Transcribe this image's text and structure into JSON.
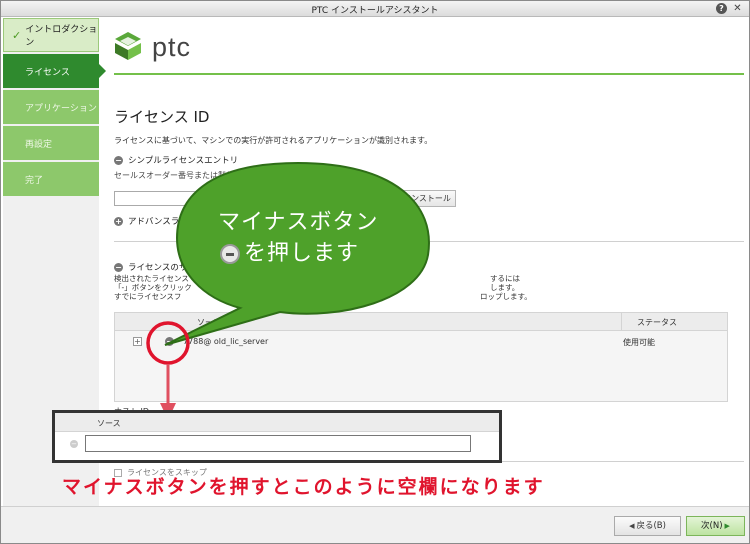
{
  "window": {
    "title": "PTC インストールアシスタント",
    "help_icon": "question-icon",
    "close_icon": "close-icon"
  },
  "sidebar": {
    "items": [
      {
        "label": "イントロダクション",
        "state": "done"
      },
      {
        "label": "ライセンス",
        "state": "active"
      },
      {
        "label": "アプリケーション",
        "state": "pending"
      },
      {
        "label": "再設定",
        "state": "pending"
      },
      {
        "label": "完了",
        "state": "pending"
      }
    ]
  },
  "brand": {
    "name": "ptc",
    "accent": "#74c04a"
  },
  "main": {
    "title": "ライセンス ID",
    "description": "ライセンスに基づいて、マシンでの実行が許可されるアプリケーションが識別されます。",
    "simple_entry": {
      "toggle": "−",
      "label": "シンプルライセンスエントリ",
      "sales_label": "セールスオーダー番号または製品",
      "input_value": "",
      "install_button": "インストール"
    },
    "advanced": {
      "toggle": "+",
      "label": "アドバンスライ"
    },
    "summary": {
      "toggle": "−",
      "label": "ライセンスのサマ",
      "line1a": "検出されたライセンス",
      "line1b": "するには",
      "line2a": "「-」ボタンをクリック",
      "line2b": "します。",
      "line3a": "すでにライセンスフ",
      "line3b": "ロップします。"
    },
    "table": {
      "col_source": "ソース",
      "col_status": "ステータス",
      "rows": [
        {
          "source": "7788@ old_lic_server",
          "status": "使用可能"
        }
      ]
    },
    "host_id": "ホスト ID: ",
    "skip_checkbox": "ライセンスをスキップ"
  },
  "footer": {
    "back": "戻る(B)",
    "next": "次(N)"
  },
  "annotation": {
    "bubble_line1": "マイナスボタン",
    "bubble_line2": "を押します",
    "bubble_color": "#4ea12a",
    "highlight_color": "#e0142d",
    "result_col_source": "ソース",
    "result_input_value": "",
    "caption": "マイナスボタンを押すとこのように空欄になります"
  }
}
